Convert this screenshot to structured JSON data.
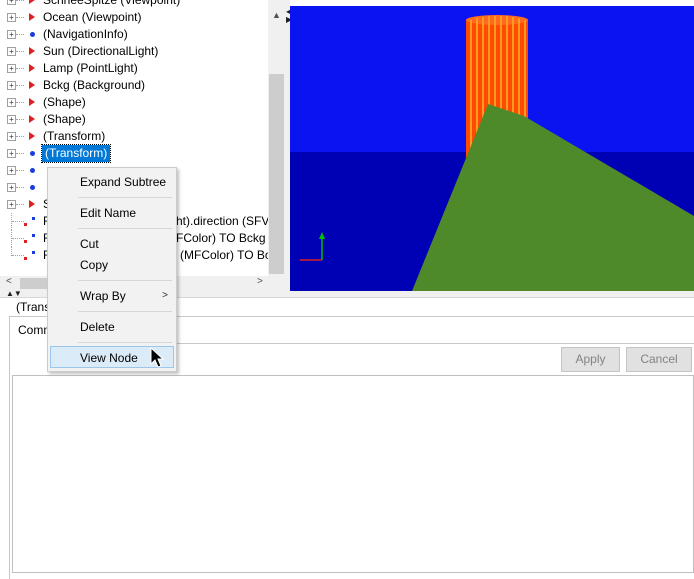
{
  "tree": {
    "items": [
      {
        "label": "SchneeSpitze (Viewpoint)",
        "icon": "red-triangle"
      },
      {
        "label": "Ocean (Viewpoint)",
        "icon": "red-triangle"
      },
      {
        "label": "(NavigationInfo)",
        "icon": "blue-dot"
      },
      {
        "label": "Sun (DirectionalLight)",
        "icon": "red-triangle"
      },
      {
        "label": "Lamp (PointLight)",
        "icon": "red-triangle"
      },
      {
        "label": "Bckg (Background)",
        "icon": "red-triangle"
      },
      {
        "label": "(Shape)",
        "icon": "red-triangle"
      },
      {
        "label": "(Shape)",
        "icon": "red-triangle"
      },
      {
        "label": "(Transform)",
        "icon": "red-triangle"
      },
      {
        "label": "(Transform)",
        "icon": "blue-dot",
        "selected": true
      },
      {
        "label": "",
        "icon": "blue-dot"
      },
      {
        "label": "",
        "icon": "blue-dot"
      },
      {
        "label": "S",
        "icon": "red-triangle"
      }
    ],
    "routes": [
      {
        "label": "R",
        "tail": "ht).direction (SFVe"
      },
      {
        "label": "R",
        "tail": "FColor) TO Bckg (E"
      },
      {
        "label": "R",
        "tail": "(MFColor) TO Bcl"
      }
    ]
  },
  "context_menu": {
    "items": [
      {
        "label": "Expand Subtree"
      },
      {
        "label": "Edit Name"
      },
      {
        "label": "Cut"
      },
      {
        "label": "Copy"
      },
      {
        "label": "Wrap By",
        "submenu": ">"
      },
      {
        "label": "Delete"
      },
      {
        "label": "View Node"
      }
    ]
  },
  "bottom": {
    "node_title": "(Trans",
    "tab_label": "Comm",
    "apply_label": "Apply",
    "cancel_label": "Cancel"
  },
  "colors": {
    "selection": "#0078d7",
    "sky": "#0a14f0",
    "sea": "#0000b4",
    "ground": "#4f8a2a",
    "tower": "#ff4a00"
  }
}
